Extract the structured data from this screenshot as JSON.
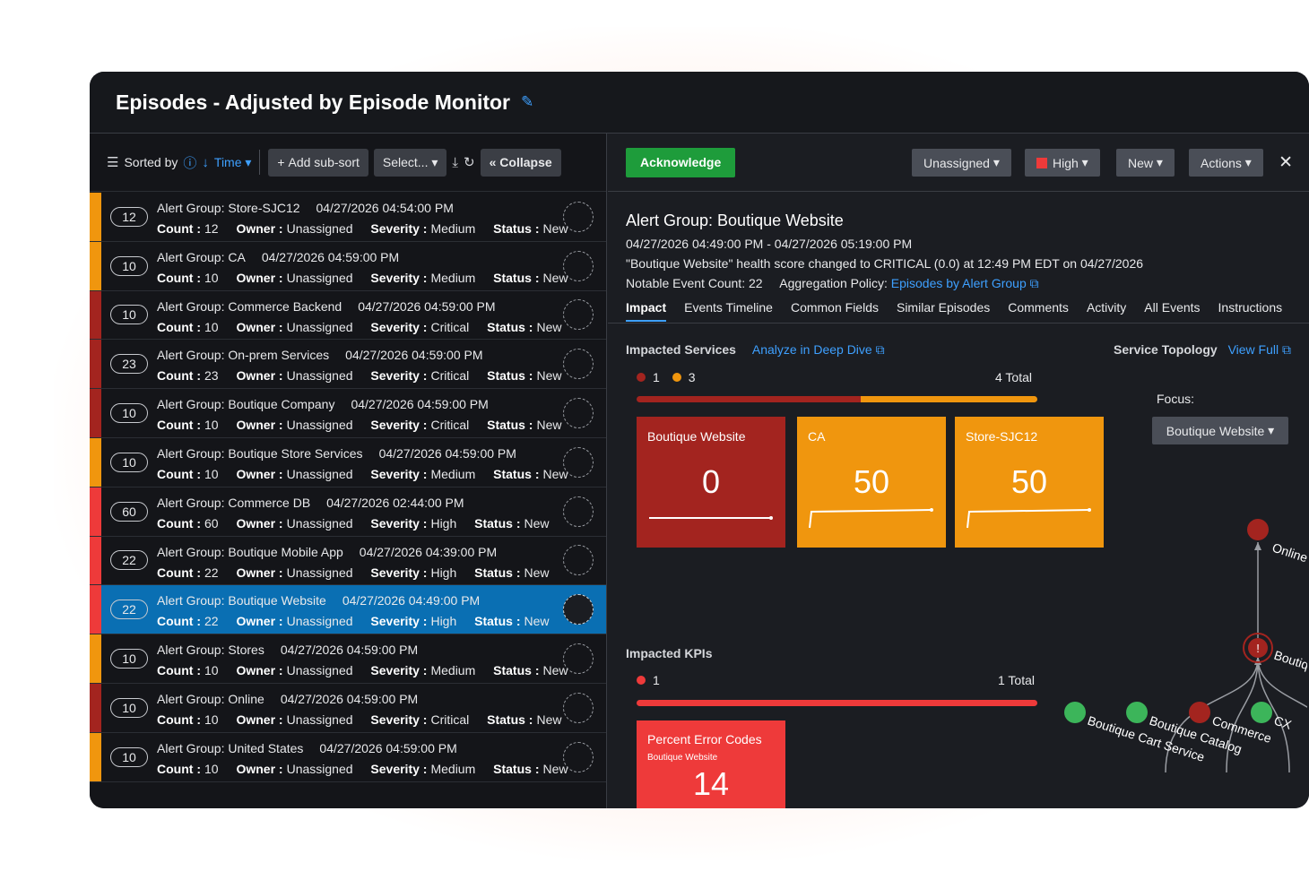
{
  "title": "Episodes - Adjusted by Episode Monitor",
  "toolbar": {
    "sorted_by": "Sorted by",
    "sort_field": "Time",
    "add_sub_sort": "Add sub-sort",
    "select": "Select...",
    "collapse": "Collapse"
  },
  "episodes": [
    {
      "count": "12",
      "group": "Alert Group: Store-SJC12",
      "time": "04/27/2026 04:54:00 PM",
      "count_label": "Count :",
      "count_val": "12",
      "owner_label": "Owner :",
      "owner": "Unassigned",
      "sev_label": "Severity :",
      "severity": "Medium",
      "status_label": "Status :",
      "status": "New",
      "color": "#f0960e"
    },
    {
      "count": "10",
      "group": "Alert Group: CA",
      "time": "04/27/2026 04:59:00 PM",
      "count_label": "Count :",
      "count_val": "10",
      "owner_label": "Owner :",
      "owner": "Unassigned",
      "sev_label": "Severity :",
      "severity": "Medium",
      "status_label": "Status :",
      "status": "New",
      "color": "#f0960e"
    },
    {
      "count": "10",
      "group": "Alert Group: Commerce Backend",
      "time": "04/27/2026 04:59:00 PM",
      "count_label": "Count :",
      "count_val": "10",
      "owner_label": "Owner :",
      "owner": "Unassigned",
      "sev_label": "Severity :",
      "severity": "Critical",
      "status_label": "Status :",
      "status": "New",
      "color": "#a3241f"
    },
    {
      "count": "23",
      "group": "Alert Group: On-prem Services",
      "time": "04/27/2026 04:59:00 PM",
      "count_label": "Count :",
      "count_val": "23",
      "owner_label": "Owner :",
      "owner": "Unassigned",
      "sev_label": "Severity :",
      "severity": "Critical",
      "status_label": "Status :",
      "status": "New",
      "color": "#a3241f"
    },
    {
      "count": "10",
      "group": "Alert Group: Boutique Company",
      "time": "04/27/2026 04:59:00 PM",
      "count_label": "Count :",
      "count_val": "10",
      "owner_label": "Owner :",
      "owner": "Unassigned",
      "sev_label": "Severity :",
      "severity": "Critical",
      "status_label": "Status :",
      "status": "New",
      "color": "#a3241f"
    },
    {
      "count": "10",
      "group": "Alert Group: Boutique Store Services",
      "time": "04/27/2026 04:59:00 PM",
      "count_label": "Count :",
      "count_val": "10",
      "owner_label": "Owner :",
      "owner": "Unassigned",
      "sev_label": "Severity :",
      "severity": "Medium",
      "status_label": "Status :",
      "status": "New",
      "color": "#f0960e"
    },
    {
      "count": "60",
      "group": "Alert Group: Commerce DB",
      "time": "04/27/2026 02:44:00 PM",
      "count_label": "Count :",
      "count_val": "60",
      "owner_label": "Owner :",
      "owner": "Unassigned",
      "sev_label": "Severity :",
      "severity": "High",
      "status_label": "Status :",
      "status": "New",
      "color": "#ee3a3a"
    },
    {
      "count": "22",
      "group": "Alert Group: Boutique Mobile App",
      "time": "04/27/2026 04:39:00 PM",
      "count_label": "Count :",
      "count_val": "22",
      "owner_label": "Owner :",
      "owner": "Unassigned",
      "sev_label": "Severity :",
      "severity": "High",
      "status_label": "Status :",
      "status": "New",
      "color": "#ee3a3a"
    },
    {
      "count": "22",
      "group": "Alert Group: Boutique Website",
      "time": "04/27/2026 04:49:00 PM",
      "count_label": "Count :",
      "count_val": "22",
      "owner_label": "Owner :",
      "owner": "Unassigned",
      "sev_label": "Severity :",
      "severity": "High",
      "status_label": "Status :",
      "status": "New",
      "color": "#ee3a3a",
      "selected": true
    },
    {
      "count": "10",
      "group": "Alert Group: Stores",
      "time": "04/27/2026 04:59:00 PM",
      "count_label": "Count :",
      "count_val": "10",
      "owner_label": "Owner :",
      "owner": "Unassigned",
      "sev_label": "Severity :",
      "severity": "Medium",
      "status_label": "Status :",
      "status": "New",
      "color": "#f0960e"
    },
    {
      "count": "10",
      "group": "Alert Group: Online",
      "time": "04/27/2026 04:59:00 PM",
      "count_label": "Count :",
      "count_val": "10",
      "owner_label": "Owner :",
      "owner": "Unassigned",
      "sev_label": "Severity :",
      "severity": "Critical",
      "status_label": "Status :",
      "status": "New",
      "color": "#a3241f"
    },
    {
      "count": "10",
      "group": "Alert Group: United States",
      "time": "04/27/2026 04:59:00 PM",
      "count_label": "Count :",
      "count_val": "10",
      "owner_label": "Owner :",
      "owner": "Unassigned",
      "sev_label": "Severity :",
      "severity": "Medium",
      "status_label": "Status :",
      "status": "New",
      "color": "#f0960e"
    }
  ],
  "actions": {
    "acknowledge": "Acknowledge",
    "owner": "Unassigned",
    "severity": "High",
    "status": "New",
    "actions": "Actions"
  },
  "detail": {
    "title": "Alert Group: Boutique Website",
    "range": "04/27/2026 04:49:00 PM - 04/27/2026 05:19:00 PM",
    "health": "\"Boutique Website\" health score changed to CRITICAL (0.0) at 12:49 PM EDT on 04/27/2026",
    "notable": "Notable Event Count: 22",
    "aggregation_label": "Aggregation Policy:",
    "aggregation_link": "Episodes by Alert Group"
  },
  "tabs": [
    "Impact",
    "Events Timeline",
    "Common Fields",
    "Similar Episodes",
    "Comments",
    "Activity",
    "All Events",
    "Instructions"
  ],
  "impact": {
    "services_label": "Impacted Services",
    "deep_dive": "Analyze in Deep Dive",
    "critical_count": "1",
    "high_count": "3",
    "services_total": "4 Total",
    "services_critical_fraction": 0.56,
    "tiles": [
      {
        "name": "Boutique Website",
        "value": "0",
        "color": "#a3241f"
      },
      {
        "name": "CA",
        "value": "50",
        "color": "#f0960e"
      },
      {
        "name": "Store-SJC12",
        "value": "50",
        "color": "#f0960e"
      }
    ],
    "kpis_label": "Impacted KPIs",
    "kpi_count": "1",
    "kpi_total": "1 Total",
    "kpi_tile": {
      "name": "Percent Error Codes",
      "service": "Boutique Website",
      "value": "14",
      "color": "#ee3a3a"
    }
  },
  "topology": {
    "label": "Service Topology",
    "view_full": "View Full",
    "focus_label": "Focus:",
    "focus_value": "Boutique Website",
    "nodes": {
      "online": "Online",
      "center": "Boutique Website",
      "cart": "Boutique Cart Service",
      "catalog": "Boutique Catalog",
      "commerce": "Commerce",
      "cx": "CX"
    }
  },
  "colors": {
    "critical": "#a3241f",
    "high": "#ee3a3a",
    "medium": "#f0960e",
    "normal": "#3cb55a",
    "accent": "#3ea0ff"
  }
}
